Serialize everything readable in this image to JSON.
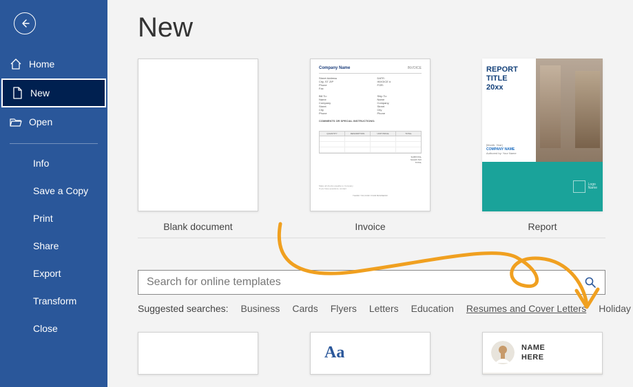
{
  "sidebar": {
    "nav": [
      {
        "label": "Home"
      },
      {
        "label": "New"
      },
      {
        "label": "Open"
      }
    ],
    "sub": [
      {
        "label": "Info"
      },
      {
        "label": "Save a Copy"
      },
      {
        "label": "Print"
      },
      {
        "label": "Share"
      },
      {
        "label": "Export"
      },
      {
        "label": "Transform"
      },
      {
        "label": "Close"
      }
    ]
  },
  "page": {
    "title": "New"
  },
  "templates": {
    "row1": [
      {
        "label": "Blank document"
      },
      {
        "label": "Invoice"
      },
      {
        "label": "Report"
      }
    ],
    "invoice": {
      "company": "Company Name",
      "badge": "INVOICE",
      "headers": [
        "QUANTITY",
        "DESCRIPTION",
        "UNIT PRICE",
        "TOTAL"
      ]
    },
    "report": {
      "title_line1": "REPORT TITLE",
      "title_line2": "20xx",
      "company": "COMPANY NAME",
      "author": "Authored by: Your Name",
      "logo_text": "Logo\nName"
    },
    "aa_text": "Aa",
    "resume_card": {
      "name1": "NAME",
      "name2": "HERE"
    }
  },
  "search": {
    "placeholder": "Search for online templates"
  },
  "suggested": {
    "label": "Suggested searches:",
    "items": [
      "Business",
      "Cards",
      "Flyers",
      "Letters",
      "Education",
      "Resumes and Cover Letters",
      "Holiday"
    ]
  }
}
